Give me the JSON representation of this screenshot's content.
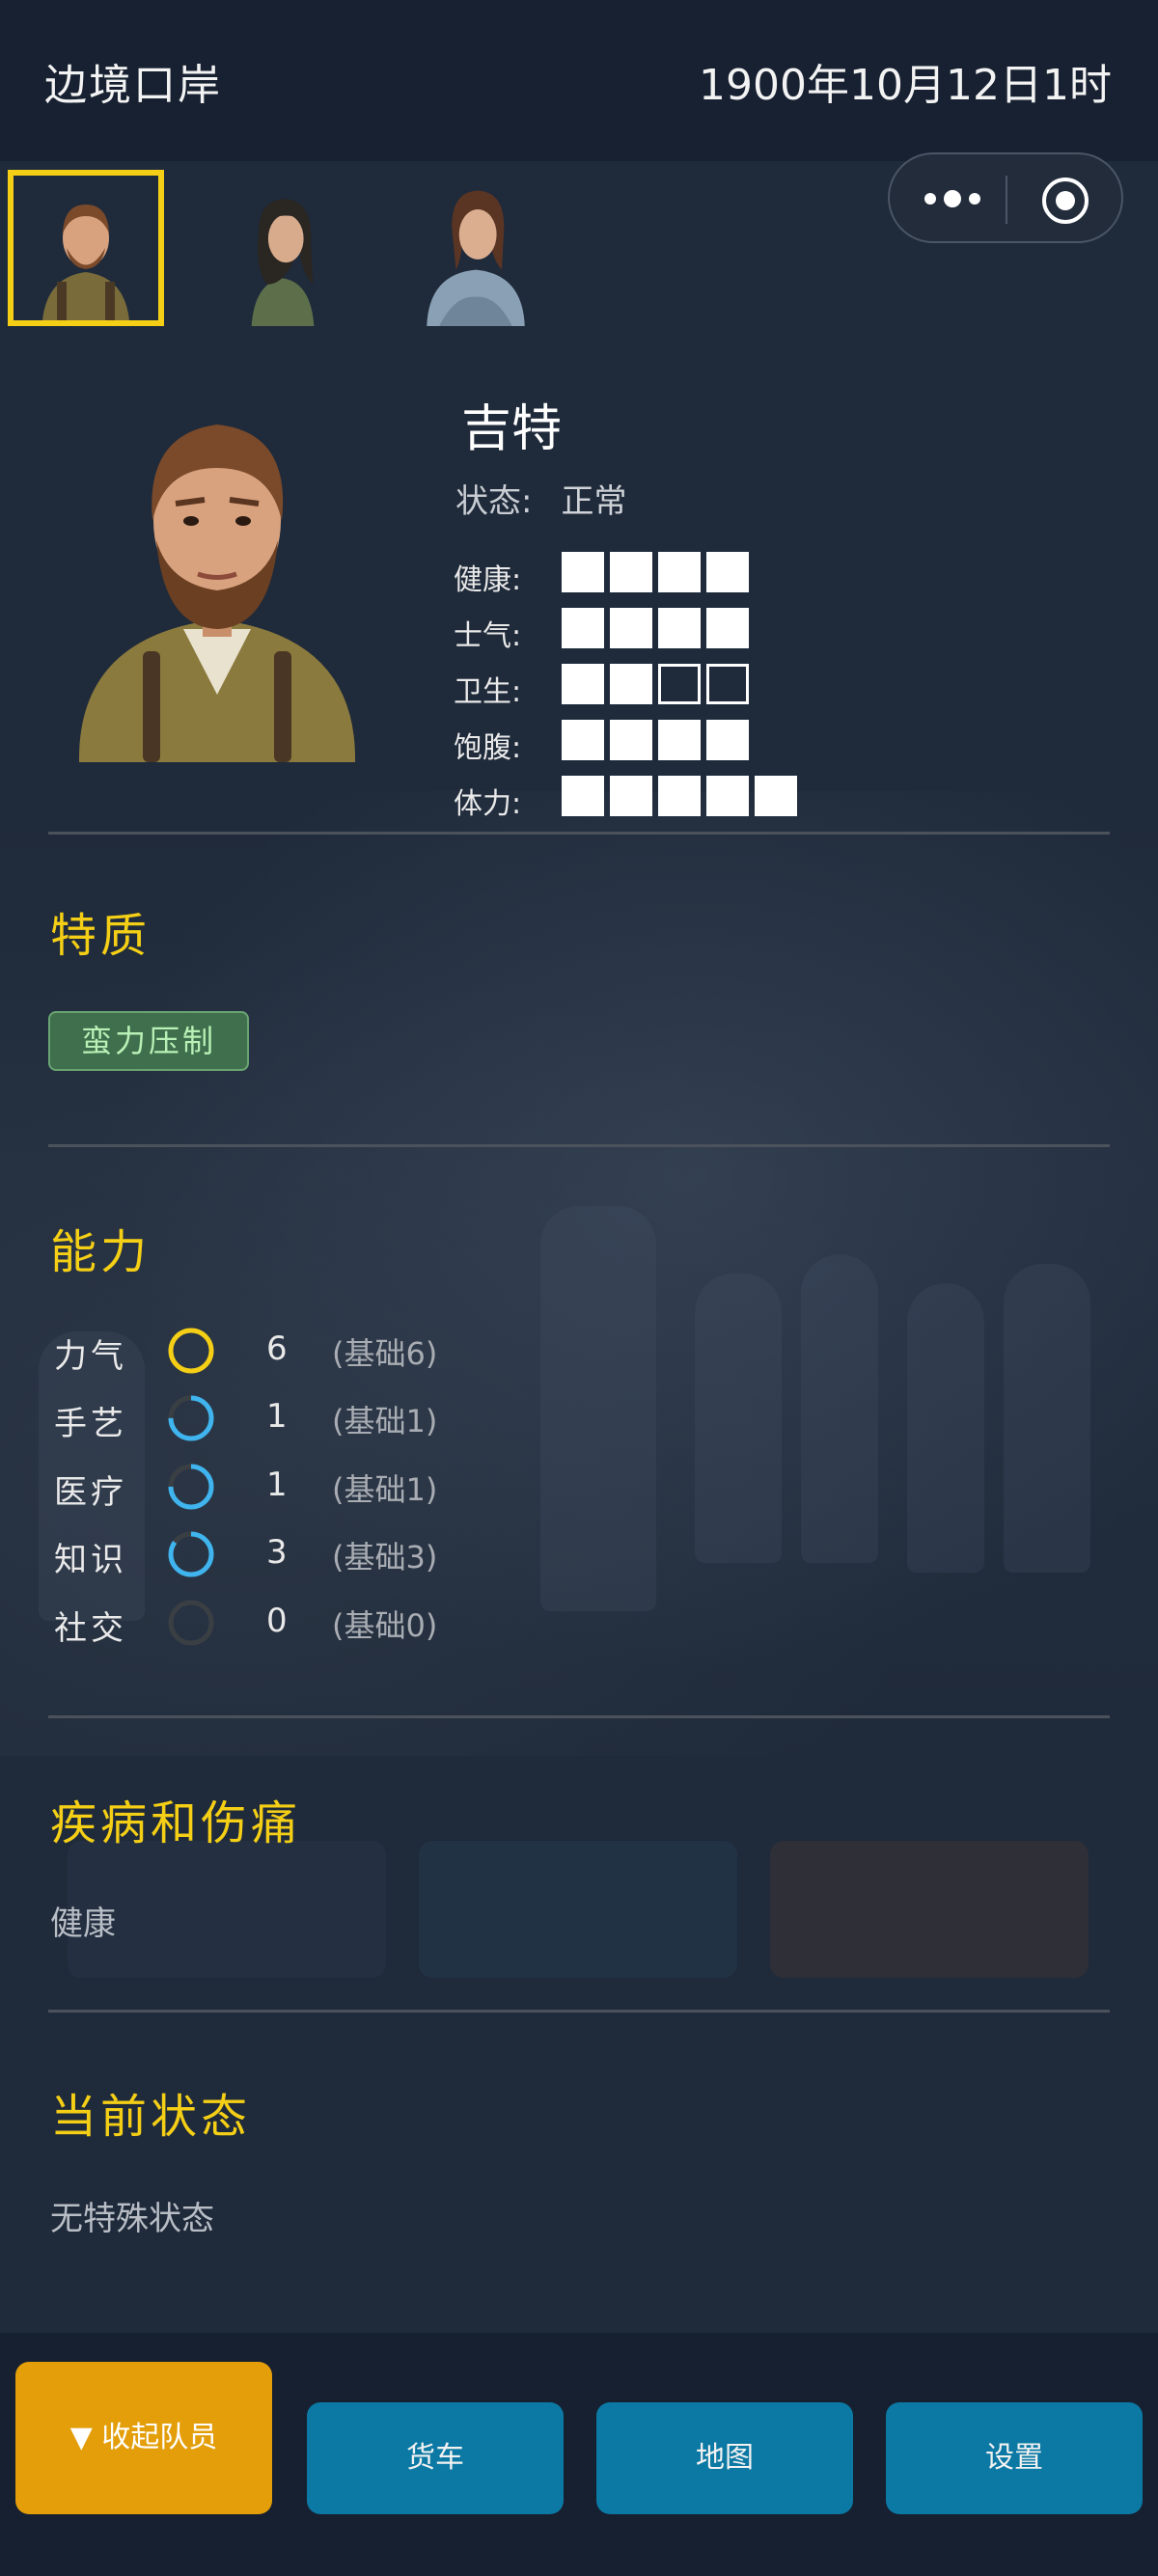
{
  "header": {
    "location": "边境口岸",
    "datetime": "1900年10月12日1时"
  },
  "party": {
    "members": [
      {
        "name": "吉特",
        "selected": true
      },
      {
        "name": "",
        "selected": false
      },
      {
        "name": "",
        "selected": false
      }
    ]
  },
  "character": {
    "name": "吉特",
    "status_label": "状态:",
    "status_value": "正常",
    "stats": [
      {
        "label": "健康:",
        "filled": 4,
        "total": 4
      },
      {
        "label": "士气:",
        "filled": 4,
        "total": 4
      },
      {
        "label": "卫生:",
        "filled": 2,
        "total": 4
      },
      {
        "label": "饱腹:",
        "filled": 4,
        "total": 4
      },
      {
        "label": "体力:",
        "filled": 5,
        "total": 5
      }
    ]
  },
  "traits": {
    "title": "特质",
    "items": [
      "蛮力压制"
    ]
  },
  "abilities": {
    "title": "能力",
    "items": [
      {
        "name": "力气",
        "value": "6",
        "base": "(基础6)",
        "level": 1.0,
        "color": "#f4cf16"
      },
      {
        "name": "手艺",
        "value": "1",
        "base": "(基础1)",
        "level": 0.75,
        "color": "#3fb4ee"
      },
      {
        "name": "医疗",
        "value": "1",
        "base": "(基础1)",
        "level": 0.75,
        "color": "#3fb4ee"
      },
      {
        "name": "知识",
        "value": "3",
        "base": "(基础3)",
        "level": 0.85,
        "color": "#3fb4ee"
      },
      {
        "name": "社交",
        "value": "0",
        "base": "(基础0)",
        "level": 0.0,
        "color": "#3a3f44"
      }
    ]
  },
  "illness": {
    "title": "疾病和伤痛",
    "text": "健康"
  },
  "current_status": {
    "title": "当前状态",
    "text": "无特殊状态"
  },
  "bottom_nav": {
    "collapse_label": "▼ 收起队员",
    "truck_label": "货车",
    "map_label": "地图",
    "settings_label": "设置"
  },
  "colors": {
    "accent": "#f4cf16",
    "collapse_button": "#e39e09",
    "nav_button": "#0b79a4",
    "trait_chip": "#3f6f4c"
  }
}
